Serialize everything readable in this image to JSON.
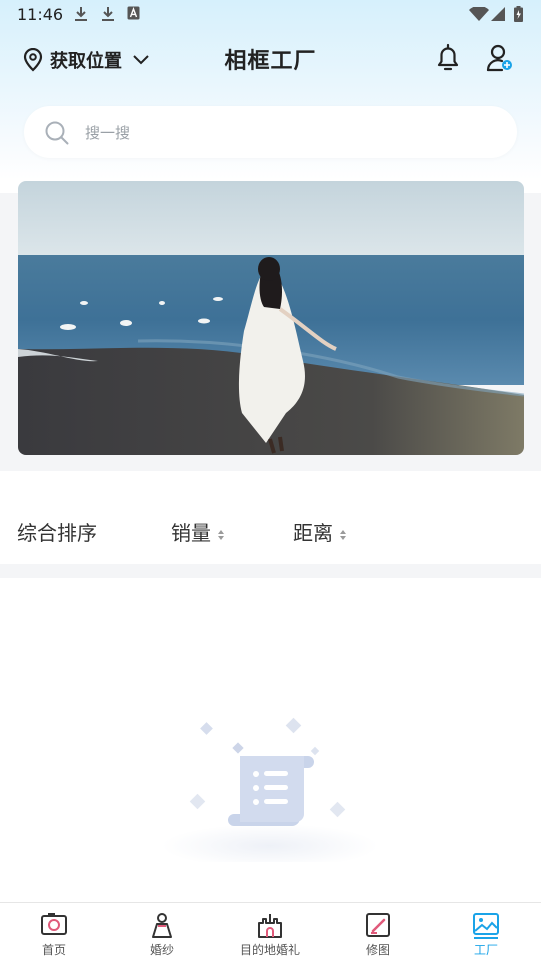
{
  "status_bar": {
    "time": "11:46"
  },
  "header": {
    "location_label": "获取位置",
    "title": "相框工厂"
  },
  "search": {
    "placeholder": "搜一搜"
  },
  "sort_bar": {
    "items": [
      {
        "label": "综合排序"
      },
      {
        "label": "销量"
      },
      {
        "label": "距离"
      }
    ]
  },
  "tabbar": {
    "items": [
      {
        "label": "首页",
        "icon": "camera-icon"
      },
      {
        "label": "婚纱",
        "icon": "bride-icon"
      },
      {
        "label": "目的地婚礼",
        "icon": "castle-icon"
      },
      {
        "label": "修图",
        "icon": "edit-photo-icon"
      },
      {
        "label": "工厂",
        "icon": "picture-icon",
        "active": true
      }
    ]
  },
  "colors": {
    "accent": "#1aa3e8",
    "header_bg": "#d6f0fc",
    "empty_illus": "#c7d3ea"
  }
}
